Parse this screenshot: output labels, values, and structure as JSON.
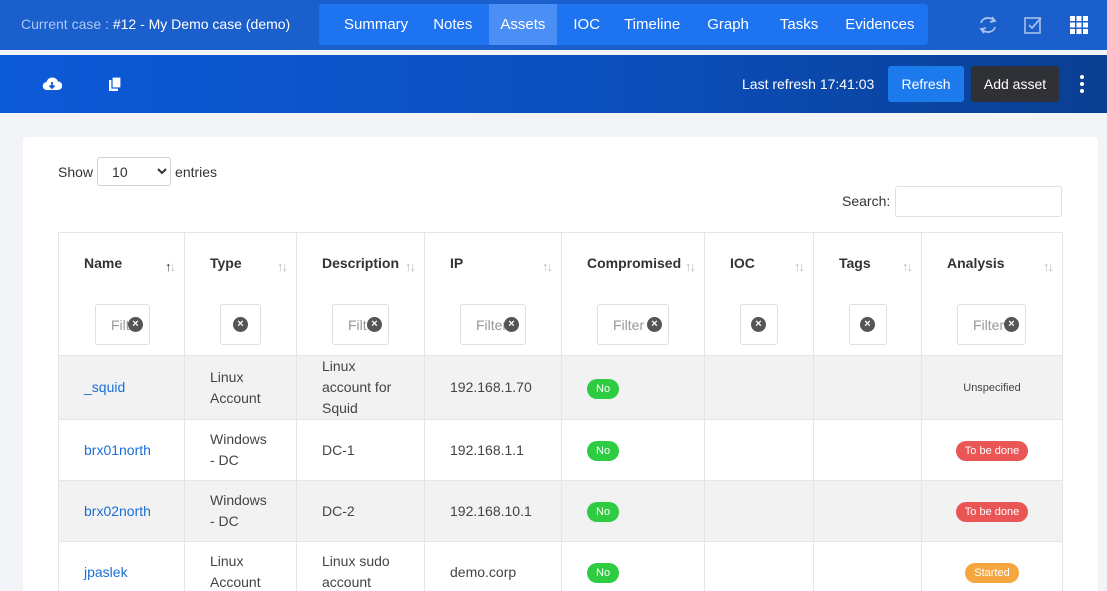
{
  "case": {
    "label": "Current case : ",
    "name": "#12 - My Demo case (demo)"
  },
  "tabs": [
    {
      "label": "Summary"
    },
    {
      "label": "Notes"
    },
    {
      "label": "Assets",
      "active": true
    },
    {
      "label": "IOC"
    },
    {
      "label": "Timeline"
    },
    {
      "label": "Graph"
    },
    {
      "label": "Tasks"
    },
    {
      "label": "Evidences"
    }
  ],
  "top_icons": [
    "sync-icon",
    "checkbox-icon",
    "apps-grid-icon"
  ],
  "toolbar": {
    "icons": [
      "cloud-download-icon",
      "copy-icon"
    ],
    "last_refresh": "Last refresh 17:41:03",
    "refresh_label": "Refresh",
    "add_asset_label": "Add asset"
  },
  "controls": {
    "show_label": "Show",
    "entries_value": "10",
    "entries_label": "entries",
    "search_label": "Search:"
  },
  "columns": [
    {
      "label": "Name",
      "filter_placeholder": "Filter"
    },
    {
      "label": "Type",
      "filter_placeholder": ""
    },
    {
      "label": "Description",
      "filter_placeholder": "Filter"
    },
    {
      "label": "IP",
      "filter_placeholder": "Filter"
    },
    {
      "label": "Compromised",
      "filter_placeholder": "Filter"
    },
    {
      "label": "IOC",
      "filter_placeholder": ""
    },
    {
      "label": "Tags",
      "filter_placeholder": ""
    },
    {
      "label": "Analysis",
      "filter_placeholder": "Filter"
    }
  ],
  "rows": [
    {
      "name": "_squid",
      "type": "Linux Account",
      "description": "Linux account for Squid",
      "ip": "192.168.1.70",
      "compromised": "No",
      "ioc": "",
      "tags": "",
      "analysis": "Unspecified",
      "analysis_status": "unspecified"
    },
    {
      "name": "brx01north",
      "type": "Windows - DC",
      "description": "DC-1",
      "ip": "192.168.1.1",
      "compromised": "No",
      "ioc": "",
      "tags": "",
      "analysis": "To be done",
      "analysis_status": "todo"
    },
    {
      "name": "brx02north",
      "type": "Windows - DC",
      "description": "DC-2",
      "ip": "192.168.10.1",
      "compromised": "No",
      "ioc": "",
      "tags": "",
      "analysis": "To be done",
      "analysis_status": "todo"
    },
    {
      "name": "jpaslek",
      "type": "Linux Account",
      "description": "Linux sudo account",
      "ip": "demo.corp",
      "compromised": "No",
      "ioc": "",
      "tags": "",
      "analysis": "Started",
      "analysis_status": "started"
    }
  ],
  "colors": {
    "topbar": "#1a5fcc",
    "tabs_bg": "#1e73f0",
    "tab_active": "#4b8ef5",
    "refresh_button": "#1c7aec",
    "add_button": "#2f3136",
    "pill_no": "#2ecc40",
    "pill_todo": "#ea5656",
    "pill_started": "#f5a640",
    "link": "#1a6fd8"
  }
}
